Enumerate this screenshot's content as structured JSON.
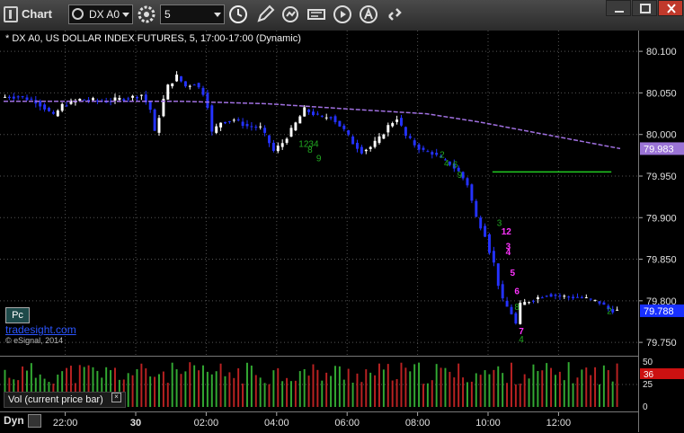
{
  "toolbar": {
    "app_title": "Chart",
    "symbol": "DX A0",
    "interval": "5"
  },
  "chart": {
    "title": "* DX A0, US DOLLAR INDEX FUTURES, 5, 17:00-17:00 (Dynamic)",
    "pc_badge": "Pc",
    "brand": "tradesight.com",
    "copyright": "© eSignal, 2014",
    "last_price_label": "79.788",
    "ma_price_label": "79.983",
    "colors": {
      "up": "#ffffff",
      "down": "#2432ff",
      "ma": "#a070e0",
      "support": "#22cc22",
      "count_green": "#22aa22",
      "count_magenta": "#ff33ff"
    }
  },
  "volume": {
    "label": "Vol (current price bar)",
    "close": "×",
    "current_label": "36",
    "scale": [
      "50",
      "25",
      "0"
    ]
  },
  "footer": {
    "dyn": "Dyn"
  },
  "chart_data": {
    "type": "candlestick",
    "title": "* DX A0, US DOLLAR INDEX FUTURES, 5, 17:00-17:00 (Dynamic)",
    "x_ticks": [
      "22:00",
      "30",
      "02:00",
      "04:00",
      "06:00",
      "08:00",
      "10:00",
      "12:00"
    ],
    "y_ticks": [
      80.1,
      80.05,
      80.0,
      79.95,
      79.9,
      79.85,
      79.8,
      79.75
    ],
    "ylim": [
      79.735,
      80.125
    ],
    "last_price": 79.788,
    "moving_average_last": 79.983,
    "support_level": 79.955,
    "price_path": [
      [
        0,
        80.045
      ],
      [
        4,
        80.046
      ],
      [
        8,
        80.04
      ],
      [
        10,
        80.032
      ],
      [
        12,
        80.022
      ],
      [
        14,
        80.035
      ],
      [
        18,
        80.042
      ],
      [
        24,
        80.04
      ],
      [
        30,
        80.045
      ],
      [
        32,
        80.048
      ],
      [
        34,
        80.03
      ],
      [
        35,
        80.002
      ],
      [
        37,
        80.042
      ],
      [
        38,
        80.058
      ],
      [
        40,
        80.07
      ],
      [
        42,
        80.058
      ],
      [
        44,
        80.062
      ],
      [
        46,
        80.05
      ],
      [
        47,
        80.035
      ],
      [
        48,
        80.002
      ],
      [
        50,
        80.015
      ],
      [
        53,
        80.018
      ],
      [
        56,
        80.01
      ],
      [
        59,
        80.008
      ],
      [
        61,
        79.99
      ],
      [
        62,
        79.98
      ],
      [
        64,
        79.99
      ],
      [
        66,
        80.005
      ],
      [
        69,
        80.03
      ],
      [
        71,
        80.025
      ],
      [
        73,
        80.02
      ],
      [
        75,
        80.022
      ],
      [
        78,
        80.005
      ],
      [
        80,
        79.99
      ],
      [
        82,
        79.98
      ],
      [
        84,
        79.985
      ],
      [
        86,
        79.995
      ],
      [
        88,
        80.01
      ],
      [
        90,
        80.02
      ],
      [
        92,
        79.998
      ],
      [
        94,
        79.988
      ],
      [
        96,
        79.98
      ],
      [
        98,
        79.978
      ],
      [
        100,
        79.97
      ],
      [
        102,
        79.965
      ],
      [
        104,
        79.955
      ],
      [
        106,
        79.94
      ],
      [
        107,
        79.92
      ],
      [
        108,
        79.9
      ],
      [
        110,
        79.88
      ],
      [
        111,
        79.86
      ],
      [
        112,
        79.845
      ],
      [
        113,
        79.82
      ],
      [
        114,
        79.8
      ],
      [
        116,
        79.785
      ],
      [
        117,
        79.772
      ],
      [
        118,
        79.795
      ],
      [
        120,
        79.8
      ],
      [
        124,
        79.808
      ],
      [
        128,
        79.805
      ],
      [
        132,
        79.804
      ],
      [
        136,
        79.798
      ],
      [
        138,
        79.79
      ],
      [
        140,
        79.788
      ]
    ],
    "bars_total": 140,
    "x_tick_bar_index": [
      14,
      30,
      46,
      62,
      78,
      94,
      110,
      126
    ],
    "ma_path": [
      [
        0,
        80.04
      ],
      [
        40,
        80.04
      ],
      [
        60,
        80.037
      ],
      [
        80,
        80.03
      ],
      [
        96,
        80.025
      ],
      [
        108,
        80.015
      ],
      [
        118,
        80.005
      ],
      [
        128,
        79.995
      ],
      [
        140,
        79.983
      ]
    ],
    "td_counts": [
      {
        "bar": 67,
        "price": 79.985,
        "text": "1234",
        "color": "green"
      },
      {
        "bar": 69,
        "price": 79.978,
        "text": "8",
        "color": "green"
      },
      {
        "bar": 71,
        "price": 79.968,
        "text": "9",
        "color": "green"
      },
      {
        "bar": 99,
        "price": 79.972,
        "text": "2",
        "color": "green"
      },
      {
        "bar": 100,
        "price": 79.962,
        "text": "4",
        "color": "green"
      },
      {
        "bar": 102,
        "price": 79.96,
        "text": "6",
        "color": "green"
      },
      {
        "bar": 103,
        "price": 79.948,
        "text": "9",
        "color": "green"
      },
      {
        "bar": 112,
        "price": 79.89,
        "text": "3",
        "color": "green"
      },
      {
        "bar": 113,
        "price": 79.88,
        "text": "12",
        "color": "magenta"
      },
      {
        "bar": 114,
        "price": 79.862,
        "text": "3",
        "color": "magenta"
      },
      {
        "bar": 114,
        "price": 79.855,
        "text": "4",
        "color": "magenta"
      },
      {
        "bar": 115,
        "price": 79.83,
        "text": "5",
        "color": "magenta"
      },
      {
        "bar": 116,
        "price": 79.808,
        "text": "6",
        "color": "magenta"
      },
      {
        "bar": 116,
        "price": 79.789,
        "text": "8",
        "color": "green"
      },
      {
        "bar": 117,
        "price": 79.76,
        "text": "7",
        "color": "magenta"
      },
      {
        "bar": 117,
        "price": 79.75,
        "text": "4",
        "color": "green"
      },
      {
        "bar": 137,
        "price": 79.784,
        "text": "2",
        "color": "green"
      }
    ],
    "volume_ylim": [
      0,
      50
    ],
    "volume_current": 36
  }
}
